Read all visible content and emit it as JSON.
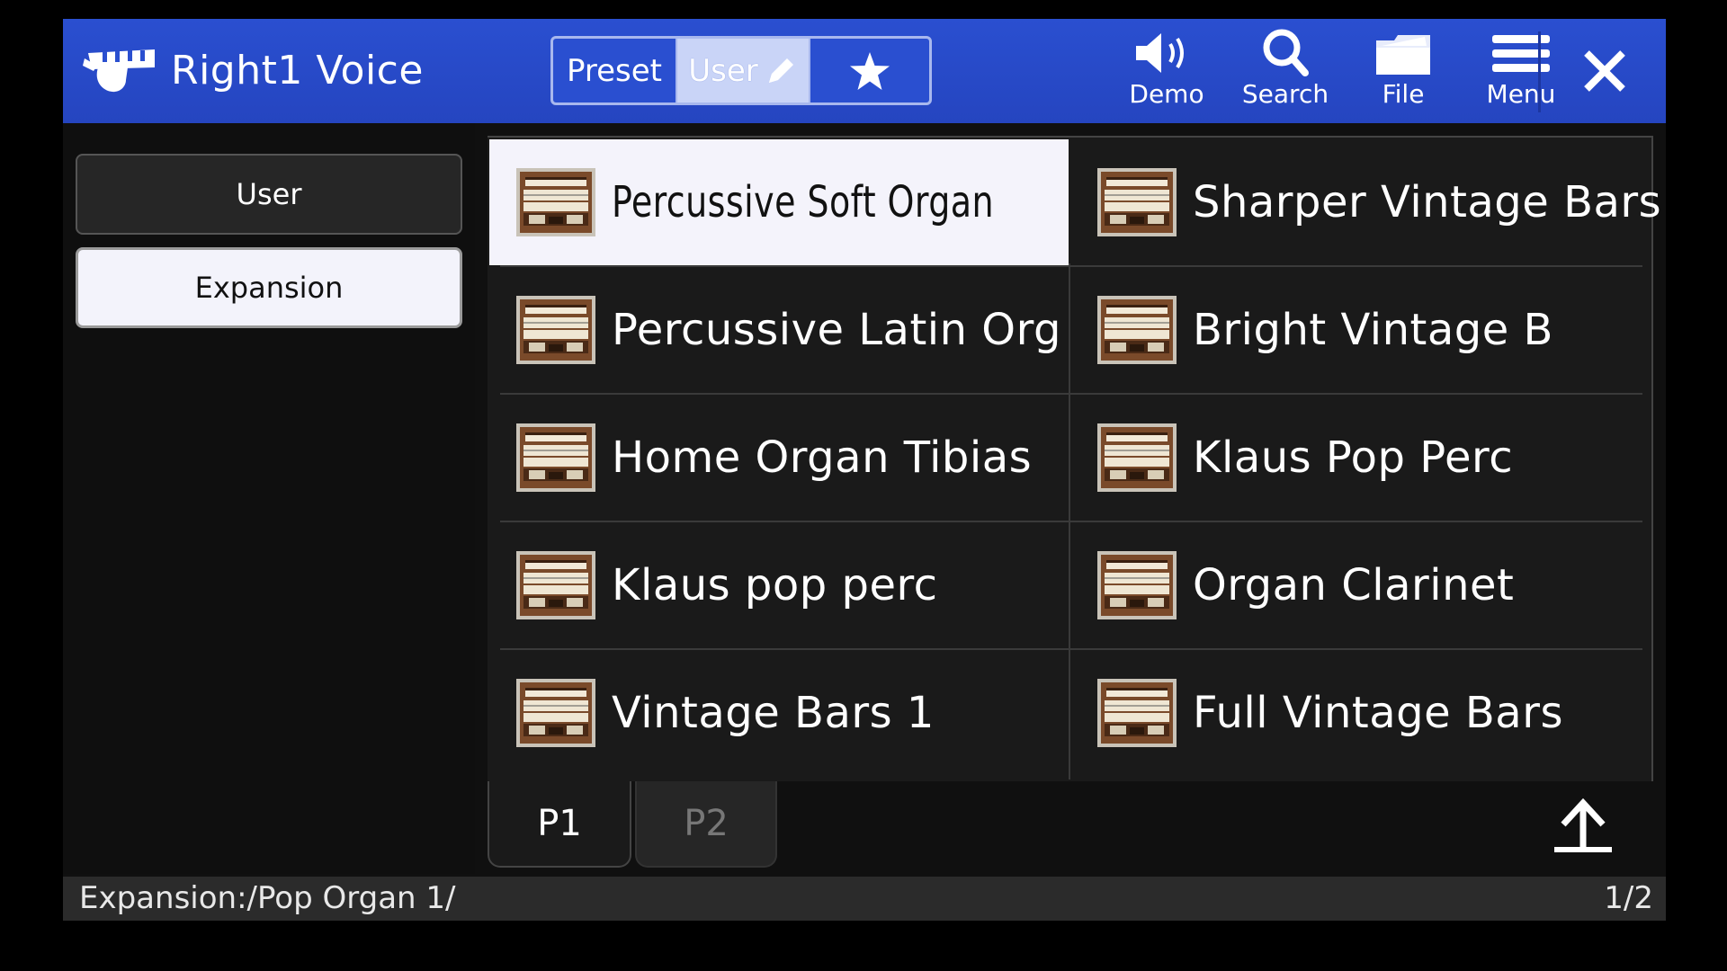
{
  "header": {
    "title": "Right1 Voice",
    "tabs": {
      "preset": "Preset",
      "user": "User"
    },
    "tools": {
      "demo": "Demo",
      "search": "Search",
      "file": "File",
      "menu": "Menu"
    }
  },
  "left_panel": {
    "items": [
      "User",
      "Expansion"
    ],
    "selected": "Expansion"
  },
  "voices": [
    {
      "name": "Percussive Soft Organ",
      "selected": true
    },
    {
      "name": "Sharper Vintage Bars"
    },
    {
      "name": "Percussive Latin Org"
    },
    {
      "name": "Bright Vintage B"
    },
    {
      "name": "Home Organ Tibias"
    },
    {
      "name": "Klaus Pop Perc"
    },
    {
      "name": "Klaus pop perc"
    },
    {
      "name": "Organ Clarinet"
    },
    {
      "name": "Vintage Bars 1"
    },
    {
      "name": "Full Vintage Bars"
    }
  ],
  "pages": {
    "tabs": [
      "P1",
      "P2"
    ],
    "active": "P1"
  },
  "status": {
    "path": "Expansion:/Pop Organ 1/",
    "page": "1/2"
  },
  "colors": {
    "header": "#2a4fd0",
    "selected": "#f4f3fb",
    "background": "#101010"
  }
}
